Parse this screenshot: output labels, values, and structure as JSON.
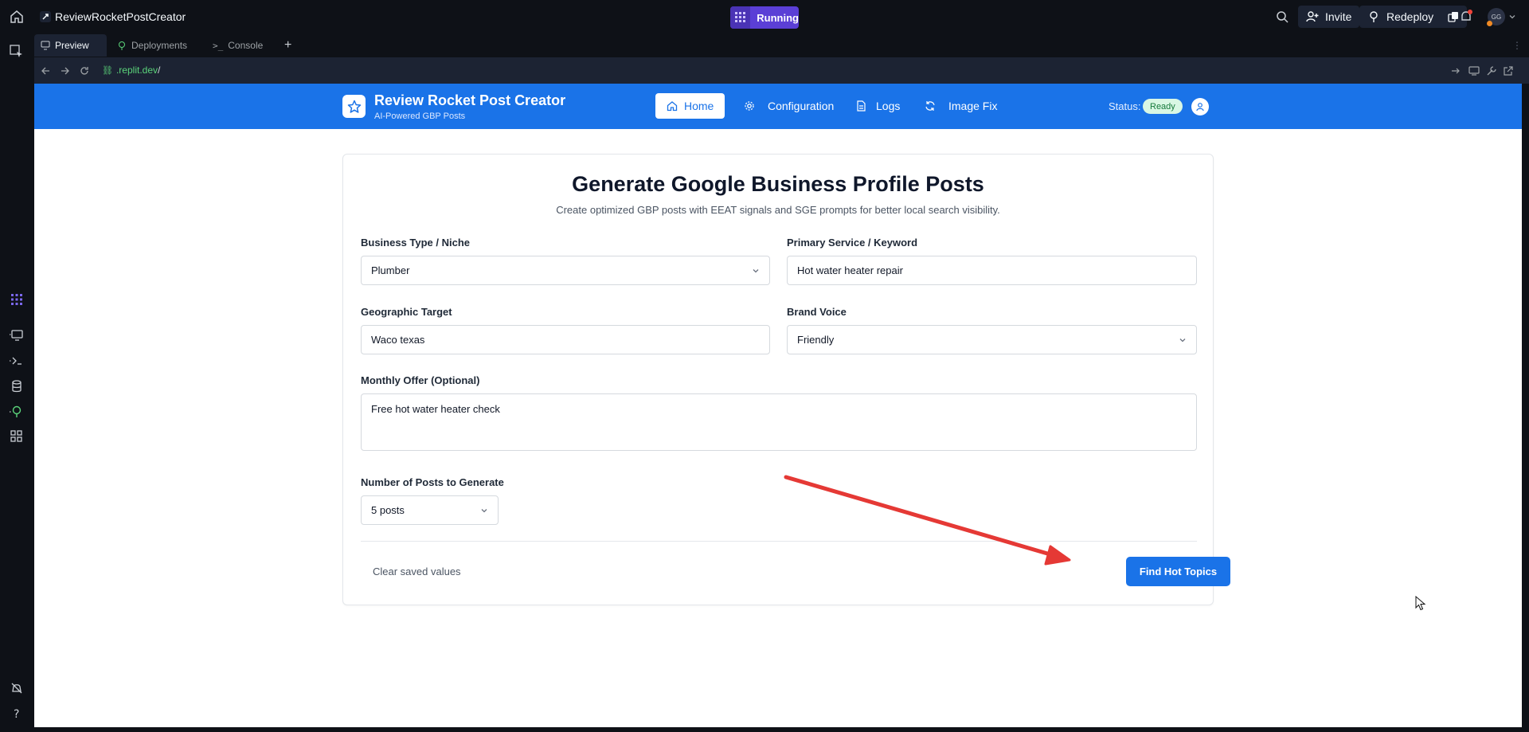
{
  "ide": {
    "repl_name": "ReviewRocketPostCreator",
    "run_status": "Running",
    "invite_label": "Invite",
    "redeploy_label": "Redeploy",
    "user_initials": "GG",
    "tabs": [
      {
        "label": "Preview",
        "icon": "monitor-icon"
      },
      {
        "label": "Deployments",
        "icon": "deploy-icon"
      },
      {
        "label": "Console",
        "icon": "terminal-icon"
      }
    ],
    "url": {
      "host": ".replit.dev",
      "path": "/"
    }
  },
  "app": {
    "title": "Review Rocket Post Creator",
    "subtitle": "AI-Powered GBP Posts",
    "nav": [
      {
        "label": "Home",
        "icon": "home-icon",
        "active": true
      },
      {
        "label": "Configuration",
        "icon": "gear-icon"
      },
      {
        "label": "Logs",
        "icon": "document-icon"
      },
      {
        "label": "Image Fix",
        "icon": "refresh-icon"
      }
    ],
    "status_label": "Status:",
    "status_value": "Ready"
  },
  "form": {
    "heading": "Generate Google Business Profile Posts",
    "description": "Create optimized GBP posts with EEAT signals and SGE prompts for better local search visibility.",
    "business_type": {
      "label": "Business Type / Niche",
      "value": "Plumber"
    },
    "primary_service": {
      "label": "Primary Service / Keyword",
      "value": "Hot water heater repair"
    },
    "geo_target": {
      "label": "Geographic Target",
      "value": "Waco texas"
    },
    "brand_voice": {
      "label": "Brand Voice",
      "value": "Friendly"
    },
    "monthly_offer": {
      "label": "Monthly Offer (Optional)",
      "value": "Free hot water heater check"
    },
    "num_posts": {
      "label": "Number of Posts to Generate",
      "value": "5 posts"
    },
    "clear_label": "Clear saved values",
    "submit_label": "Find Hot Topics"
  },
  "colors": {
    "brand_blue": "#1a73e8",
    "run_purple": "#5b3fd6",
    "annotation_arrow": "#e53935"
  }
}
